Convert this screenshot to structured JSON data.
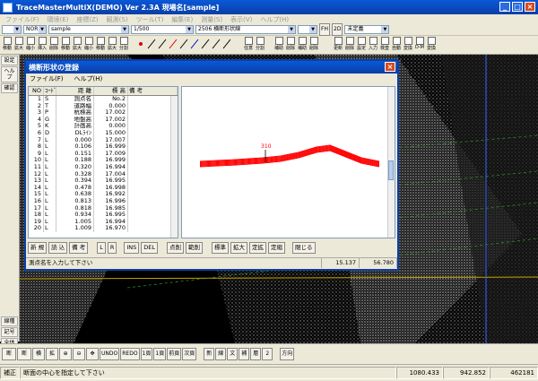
{
  "app": {
    "title": "TraceMasterMultiX(DEMO)  Ver 2.3A   現場名[sample]",
    "menu": [
      "ファイル(F)",
      "環境(E)",
      "座標(Z)",
      "観測(S)",
      "ツール(T)",
      "編集(E)",
      "測量(S)",
      "表示(V)",
      "ヘルプ(H)"
    ]
  },
  "toolbar1": {
    "combo1": "",
    "combo2": "NOR",
    "combo3": "sample",
    "scale": "1/500",
    "combo5": "2506 横断形状線",
    "mode": "未定義",
    "fh": "FH",
    "zd": "2D"
  },
  "toolbar2": {
    "items": [
      "移動",
      "拡大",
      "縮小",
      "挿入",
      "削除",
      "移動",
      "拡大",
      "縮小",
      "移動",
      "拡大",
      "分割",
      "任意",
      "分割",
      "補助",
      "削除",
      "補助",
      "削除",
      "更新",
      "削除",
      "設定",
      "入力",
      "検査",
      "自動",
      "変換",
      "D-M",
      "変換"
    ]
  },
  "left_panel": {
    "items": [
      "設定",
      "ヘルプ",
      "確認",
      "線種",
      "記号",
      "全体",
      "登録"
    ]
  },
  "dialog": {
    "title": "横断形状の登録",
    "menu": [
      "ファイル(F)",
      "ヘルプ(H)"
    ],
    "columns": [
      "NO",
      "ｺｰﾄﾞ",
      "距 離",
      "標 高",
      "備  考"
    ],
    "rows": [
      {
        "no": "1",
        "code": "S",
        "dist": "測点名",
        "elev": "No.2",
        "note": ""
      },
      {
        "no": "2",
        "code": "T",
        "dist": "道路幅",
        "elev": "0.000",
        "note": ""
      },
      {
        "no": "3",
        "code": "P",
        "dist": "杭標高",
        "elev": "17.002",
        "note": ""
      },
      {
        "no": "4",
        "code": "G",
        "dist": "地盤高",
        "elev": "17.002",
        "note": ""
      },
      {
        "no": "5",
        "code": "K",
        "dist": "計画高",
        "elev": "0.000",
        "note": ""
      },
      {
        "no": "6",
        "code": "D",
        "dist": "DLﾗｲﾝ",
        "elev": "15.000",
        "note": ""
      },
      {
        "no": "7",
        "code": "L",
        "dist": "0.000",
        "elev": "17.007",
        "note": ""
      },
      {
        "no": "8",
        "code": "L",
        "dist": "0.106",
        "elev": "16.999",
        "note": ""
      },
      {
        "no": "9",
        "code": "L",
        "dist": "0.151",
        "elev": "17.009",
        "note": ""
      },
      {
        "no": "10",
        "code": "L",
        "dist": "0.188",
        "elev": "16.999",
        "note": ""
      },
      {
        "no": "11",
        "code": "L",
        "dist": "0.320",
        "elev": "16.994",
        "note": ""
      },
      {
        "no": "12",
        "code": "L",
        "dist": "0.328",
        "elev": "17.004",
        "note": ""
      },
      {
        "no": "13",
        "code": "L",
        "dist": "0.394",
        "elev": "16.995",
        "note": ""
      },
      {
        "no": "14",
        "code": "L",
        "dist": "0.478",
        "elev": "16.998",
        "note": ""
      },
      {
        "no": "15",
        "code": "L",
        "dist": "0.638",
        "elev": "16.992",
        "note": ""
      },
      {
        "no": "16",
        "code": "L",
        "dist": "0.813",
        "elev": "16.996",
        "note": ""
      },
      {
        "no": "17",
        "code": "L",
        "dist": "0.818",
        "elev": "16.985",
        "note": ""
      },
      {
        "no": "18",
        "code": "L",
        "dist": "0.934",
        "elev": "16.995",
        "note": ""
      },
      {
        "no": "19",
        "code": "L",
        "dist": "1.005",
        "elev": "16.994",
        "note": ""
      },
      {
        "no": "20",
        "code": "L",
        "dist": "1.009",
        "elev": "16.970",
        "note": ""
      }
    ],
    "plot_label": "310",
    "buttons": [
      "新 規",
      "読 込",
      "備 考",
      "L",
      "R",
      "INS",
      "DEL",
      "点削",
      "範削",
      "標準",
      "拡大",
      "定拡",
      "定縮",
      "閉じる"
    ],
    "status": {
      "message": "測点名を入力して下さい",
      "x": "15.137",
      "y": "56.780"
    }
  },
  "bottom_toolbar": [
    "断",
    "断",
    "横",
    "拡",
    "",
    "",
    "",
    "UNDO",
    "REDO",
    "1頁",
    "1頁",
    "前頁",
    "次頁",
    "新",
    "線",
    "文",
    "補",
    "層",
    "2",
    "方向"
  ],
  "statusbar": {
    "left_label": "補正",
    "message": "断面の中心を指定して下さい",
    "x": "1080.433",
    "y": "942.852",
    "z": "462181"
  },
  "colors": {
    "accent": "#0a4fc4",
    "profile_line": "#ff0000"
  }
}
